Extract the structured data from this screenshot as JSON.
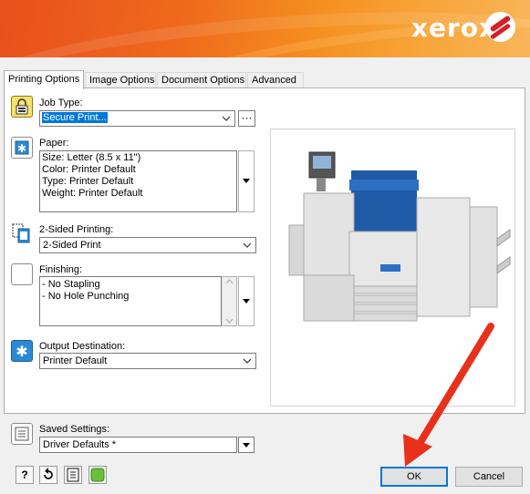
{
  "brand": {
    "logo_text": "xerox"
  },
  "tabs": [
    {
      "label": "Printing Options"
    },
    {
      "label": "Image Options"
    },
    {
      "label": "Document Options"
    },
    {
      "label": "Advanced"
    }
  ],
  "job_type": {
    "label": "Job Type:",
    "value": "Secure Print..."
  },
  "paper": {
    "label": "Paper:",
    "lines": [
      "Size: Letter (8.5 x 11\")",
      "Color: Printer Default",
      "Type: Printer Default",
      "Weight: Printer Default"
    ]
  },
  "two_sided": {
    "label": "2-Sided Printing:",
    "value": "2-Sided Print"
  },
  "finishing": {
    "label": "Finishing:",
    "lines": [
      "- No Stapling",
      "- No Hole Punching"
    ]
  },
  "output_destination": {
    "label": "Output Destination:",
    "value": "Printer Default"
  },
  "saved_settings": {
    "label": "Saved Settings:",
    "value": "Driver Defaults *"
  },
  "bottom_tools": {
    "help_label": "?"
  },
  "buttons": {
    "ok": "OK",
    "cancel": "Cancel"
  },
  "colors": {
    "accent": "#0078d7",
    "annotation_arrow": "#e8301c",
    "brand_orange": "#f07a1e"
  }
}
